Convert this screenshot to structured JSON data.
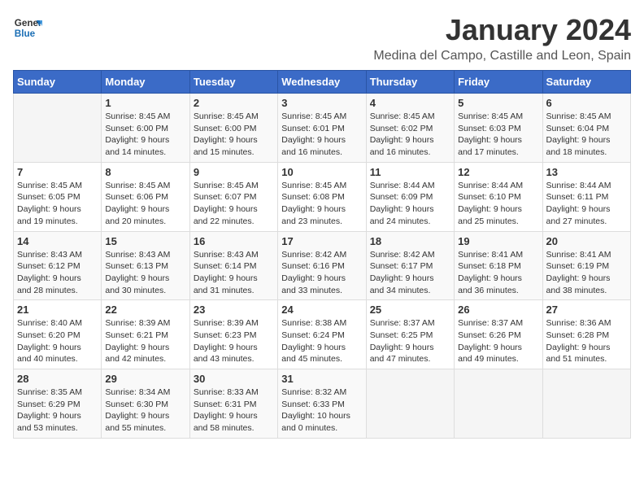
{
  "header": {
    "logo_general": "General",
    "logo_blue": "Blue",
    "month_year": "January 2024",
    "location": "Medina del Campo, Castille and Leon, Spain"
  },
  "days_of_week": [
    "Sunday",
    "Monday",
    "Tuesday",
    "Wednesday",
    "Thursday",
    "Friday",
    "Saturday"
  ],
  "weeks": [
    [
      {
        "day": "",
        "info": ""
      },
      {
        "day": "1",
        "info": "Sunrise: 8:45 AM\nSunset: 6:00 PM\nDaylight: 9 hours\nand 14 minutes."
      },
      {
        "day": "2",
        "info": "Sunrise: 8:45 AM\nSunset: 6:00 PM\nDaylight: 9 hours\nand 15 minutes."
      },
      {
        "day": "3",
        "info": "Sunrise: 8:45 AM\nSunset: 6:01 PM\nDaylight: 9 hours\nand 16 minutes."
      },
      {
        "day": "4",
        "info": "Sunrise: 8:45 AM\nSunset: 6:02 PM\nDaylight: 9 hours\nand 16 minutes."
      },
      {
        "day": "5",
        "info": "Sunrise: 8:45 AM\nSunset: 6:03 PM\nDaylight: 9 hours\nand 17 minutes."
      },
      {
        "day": "6",
        "info": "Sunrise: 8:45 AM\nSunset: 6:04 PM\nDaylight: 9 hours\nand 18 minutes."
      }
    ],
    [
      {
        "day": "7",
        "info": "Sunrise: 8:45 AM\nSunset: 6:05 PM\nDaylight: 9 hours\nand 19 minutes."
      },
      {
        "day": "8",
        "info": "Sunrise: 8:45 AM\nSunset: 6:06 PM\nDaylight: 9 hours\nand 20 minutes."
      },
      {
        "day": "9",
        "info": "Sunrise: 8:45 AM\nSunset: 6:07 PM\nDaylight: 9 hours\nand 22 minutes."
      },
      {
        "day": "10",
        "info": "Sunrise: 8:45 AM\nSunset: 6:08 PM\nDaylight: 9 hours\nand 23 minutes."
      },
      {
        "day": "11",
        "info": "Sunrise: 8:44 AM\nSunset: 6:09 PM\nDaylight: 9 hours\nand 24 minutes."
      },
      {
        "day": "12",
        "info": "Sunrise: 8:44 AM\nSunset: 6:10 PM\nDaylight: 9 hours\nand 25 minutes."
      },
      {
        "day": "13",
        "info": "Sunrise: 8:44 AM\nSunset: 6:11 PM\nDaylight: 9 hours\nand 27 minutes."
      }
    ],
    [
      {
        "day": "14",
        "info": "Sunrise: 8:43 AM\nSunset: 6:12 PM\nDaylight: 9 hours\nand 28 minutes."
      },
      {
        "day": "15",
        "info": "Sunrise: 8:43 AM\nSunset: 6:13 PM\nDaylight: 9 hours\nand 30 minutes."
      },
      {
        "day": "16",
        "info": "Sunrise: 8:43 AM\nSunset: 6:14 PM\nDaylight: 9 hours\nand 31 minutes."
      },
      {
        "day": "17",
        "info": "Sunrise: 8:42 AM\nSunset: 6:16 PM\nDaylight: 9 hours\nand 33 minutes."
      },
      {
        "day": "18",
        "info": "Sunrise: 8:42 AM\nSunset: 6:17 PM\nDaylight: 9 hours\nand 34 minutes."
      },
      {
        "day": "19",
        "info": "Sunrise: 8:41 AM\nSunset: 6:18 PM\nDaylight: 9 hours\nand 36 minutes."
      },
      {
        "day": "20",
        "info": "Sunrise: 8:41 AM\nSunset: 6:19 PM\nDaylight: 9 hours\nand 38 minutes."
      }
    ],
    [
      {
        "day": "21",
        "info": "Sunrise: 8:40 AM\nSunset: 6:20 PM\nDaylight: 9 hours\nand 40 minutes."
      },
      {
        "day": "22",
        "info": "Sunrise: 8:39 AM\nSunset: 6:21 PM\nDaylight: 9 hours\nand 42 minutes."
      },
      {
        "day": "23",
        "info": "Sunrise: 8:39 AM\nSunset: 6:23 PM\nDaylight: 9 hours\nand 43 minutes."
      },
      {
        "day": "24",
        "info": "Sunrise: 8:38 AM\nSunset: 6:24 PM\nDaylight: 9 hours\nand 45 minutes."
      },
      {
        "day": "25",
        "info": "Sunrise: 8:37 AM\nSunset: 6:25 PM\nDaylight: 9 hours\nand 47 minutes."
      },
      {
        "day": "26",
        "info": "Sunrise: 8:37 AM\nSunset: 6:26 PM\nDaylight: 9 hours\nand 49 minutes."
      },
      {
        "day": "27",
        "info": "Sunrise: 8:36 AM\nSunset: 6:28 PM\nDaylight: 9 hours\nand 51 minutes."
      }
    ],
    [
      {
        "day": "28",
        "info": "Sunrise: 8:35 AM\nSunset: 6:29 PM\nDaylight: 9 hours\nand 53 minutes."
      },
      {
        "day": "29",
        "info": "Sunrise: 8:34 AM\nSunset: 6:30 PM\nDaylight: 9 hours\nand 55 minutes."
      },
      {
        "day": "30",
        "info": "Sunrise: 8:33 AM\nSunset: 6:31 PM\nDaylight: 9 hours\nand 58 minutes."
      },
      {
        "day": "31",
        "info": "Sunrise: 8:32 AM\nSunset: 6:33 PM\nDaylight: 10 hours\nand 0 minutes."
      },
      {
        "day": "",
        "info": ""
      },
      {
        "day": "",
        "info": ""
      },
      {
        "day": "",
        "info": ""
      }
    ]
  ]
}
